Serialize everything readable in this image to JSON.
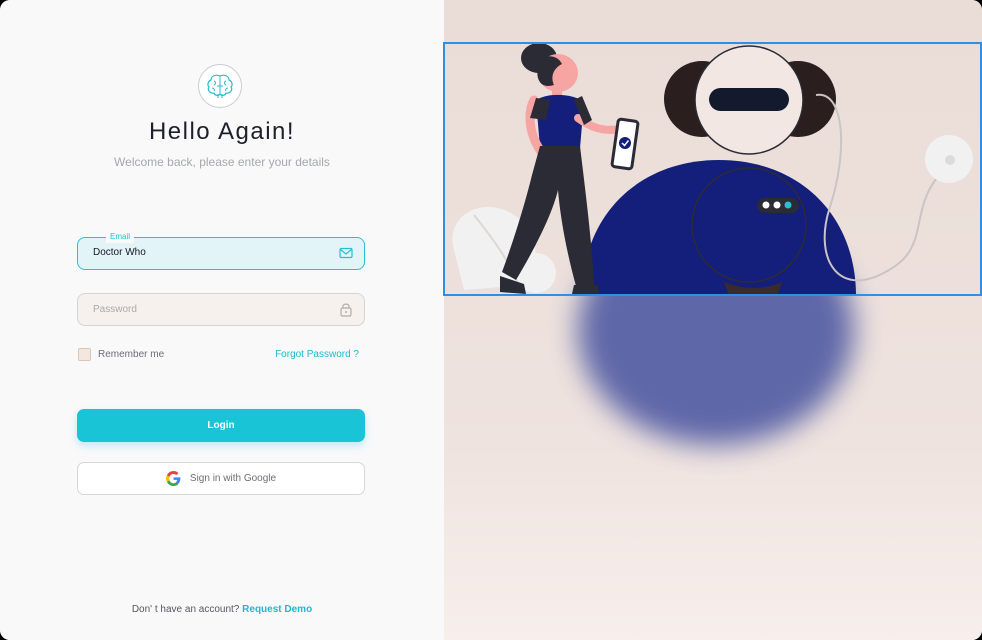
{
  "header": {
    "title": "Hello Again!",
    "subtitle": "Welcome back, please enter your details"
  },
  "logo": {
    "icon": "brain-icon"
  },
  "form": {
    "email": {
      "label": "Email",
      "value": "Doctor Who",
      "icon": "mail-icon"
    },
    "password": {
      "placeholder": "Password",
      "icon": "lock-icon"
    },
    "remember_label": "Remember me",
    "forgot_label": "Forgot Password ?",
    "login_label": "Login",
    "google_label": "Sign in with Google"
  },
  "footer": {
    "prompt": "Don' t have an account?",
    "link": "Request Demo"
  },
  "colors": {
    "accent": "#18c4d6",
    "illustration_blue": "#131f7a",
    "right_panel_bg": "#eadcd6"
  }
}
